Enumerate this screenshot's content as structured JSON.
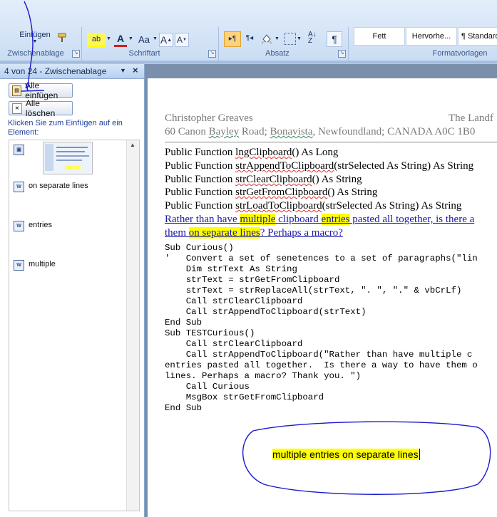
{
  "ribbon": {
    "paste_label": "Einfügen",
    "groups": {
      "clipboard": "Zwischenablage",
      "font": "Schriftart",
      "paragraph": "Absatz",
      "styles": "Formatvorlagen"
    },
    "font_buttons": [
      "ab",
      "A",
      "Aa",
      "A",
      "A"
    ],
    "paragraph_buttons": [
      "¶"
    ],
    "style_tiles": [
      "Fett",
      "Hervorhe...",
      "¶ Standard"
    ]
  },
  "clipboard_pane": {
    "title": "4 von 24 - Zwischenablage",
    "paste_all": "Alle einfügen",
    "clear_all": "Alle löschen",
    "hint": "Klicken Sie zum Einfügen auf ein Element:",
    "items": [
      {
        "label": "",
        "kind": "image"
      },
      {
        "label": "on separate lines",
        "kind": "text"
      },
      {
        "label": "entries",
        "kind": "text"
      },
      {
        "label": "multiple",
        "kind": "text"
      }
    ]
  },
  "document": {
    "header_left": "Christopher Greaves",
    "header_right": "The Landf",
    "address_pre": "60 Canon ",
    "address_wavy1": "Bayley",
    "address_mid1": " Road; ",
    "address_wavy2": "Bonavista",
    "address_post": ", Newfoundland; CANADA  A0C 1B0",
    "functions": [
      {
        "pre": "Public Function ",
        "name": "lngClipboard",
        "post": "() As Long"
      },
      {
        "pre": "Public Function ",
        "name": "strAppendToClipboard",
        "post": "(strSelected As String) As String"
      },
      {
        "pre": "Public Function ",
        "name": "strClearClipboard",
        "post": "() As String"
      },
      {
        "pre": "Public Function ",
        "name": "strGetFromClipboard",
        "post": "() As String"
      },
      {
        "pre": "Public Function ",
        "name": "strLoadToClipboard",
        "post": "(strSelected As String) As String"
      }
    ],
    "question": {
      "p1": "Rather than have ",
      "h1": "multiple",
      "p2": "  clipboard ",
      "h2": "entries",
      "p3": " pasted all together, is there a",
      "p4": "them ",
      "h3": "on separate lines",
      "p5": "?  Perhaps a macro?"
    },
    "code_lines": [
      "Sub Curious()",
      "'   Convert a set of senetences to a set of paragraphs(\"lin",
      "    Dim strText As String",
      "    strText = strGetFromClipboard",
      "    strText = strReplaceAll(strText, \". \", \".\" & vbCrLf)",
      "    Call strClearClipboard",
      "    Call strAppendToClipboard(strText)",
      "End Sub",
      "Sub TESTCurious()",
      "    Call strClearClipboard",
      "    Call strAppendToClipboard(\"Rather than have multiple c",
      "entries pasted all together.  Is there a way to have them o",
      "lines. Perhaps a macro? Thank you. \")",
      "    Call Curious",
      "    MsgBox strGetFromClipboard",
      "End Sub"
    ],
    "annotation": "multiple entries on separate lines"
  },
  "colors": {
    "highlight": "#ffff00",
    "ink": "#1a1acc",
    "link": "#1a1aa6"
  }
}
